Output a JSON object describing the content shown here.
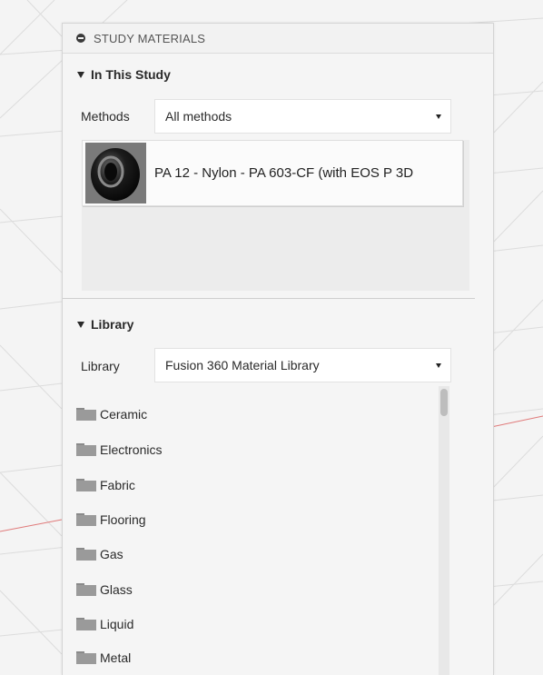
{
  "panel": {
    "title": "STUDY MATERIALS"
  },
  "in_study": {
    "section_title": "In This Study",
    "methods_label": "Methods",
    "methods_value": "All methods",
    "materials": [
      {
        "name": "PA 12 - Nylon - PA 603-CF (with EOS P 3D",
        "icon": "material-sphere-swatch"
      }
    ]
  },
  "library": {
    "section_title": "Library",
    "library_label": "Library",
    "library_value": "Fusion 360 Material Library",
    "folders": [
      {
        "label": "Ceramic",
        "icon": "folder-icon"
      },
      {
        "label": "Electronics",
        "icon": "folder-icon"
      },
      {
        "label": "Fabric",
        "icon": "folder-icon"
      },
      {
        "label": "Flooring",
        "icon": "folder-icon"
      },
      {
        "label": "Gas",
        "icon": "folder-icon"
      },
      {
        "label": "Glass",
        "icon": "folder-icon"
      },
      {
        "label": "Liquid",
        "icon": "folder-icon"
      },
      {
        "label": "Metal",
        "icon": "folder-icon"
      }
    ]
  },
  "colors": {
    "panel_bg": "#f5f5f5",
    "grid_line": "#dedede",
    "axis_red": "#e07a7a",
    "folder_gray": "#9a9a9a"
  }
}
